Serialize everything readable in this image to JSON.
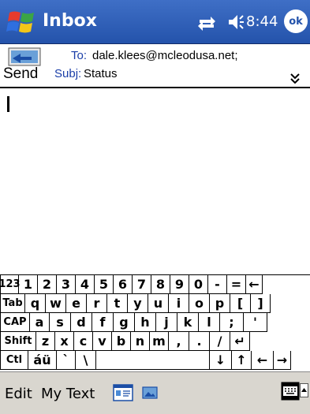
{
  "titlebar": {
    "title": "Inbox",
    "clock": "8:44",
    "ok_label": "ok"
  },
  "header": {
    "send_label": "Send",
    "to_label": "To:",
    "to_value": "dale.klees@mcleodusa.net;",
    "subj_label": "Subj:",
    "subj_value": "Status"
  },
  "keyboard": {
    "row1": [
      "123",
      "1",
      "2",
      "3",
      "4",
      "5",
      "6",
      "7",
      "8",
      "9",
      "0",
      "-",
      "=",
      "←"
    ],
    "row2": [
      "Tab",
      "q",
      "w",
      "e",
      "r",
      "t",
      "y",
      "u",
      "i",
      "o",
      "p",
      "[",
      "]"
    ],
    "row3": [
      "CAP",
      "a",
      "s",
      "d",
      "f",
      "g",
      "h",
      "j",
      "k",
      "l",
      ";",
      "'"
    ],
    "row4": [
      "Shift",
      "z",
      "x",
      "c",
      "v",
      "b",
      "n",
      "m",
      ",",
      ".",
      "/",
      "↵"
    ],
    "row5": [
      "Ctl",
      "áü",
      "`",
      "\\",
      "",
      "↓",
      "↑",
      "←",
      "→"
    ]
  },
  "menubar": {
    "edit": "Edit",
    "my_text": "My Text"
  }
}
